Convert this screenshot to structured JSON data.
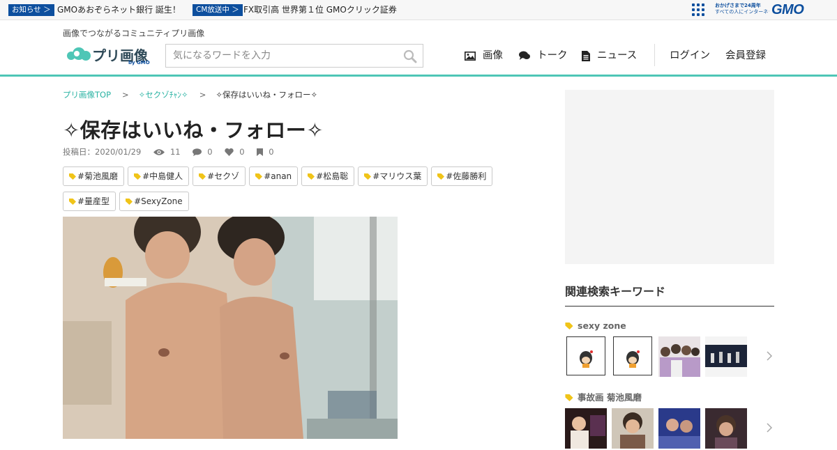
{
  "topbar": {
    "badge1": "お知らせ ＞",
    "text1": "GMOあおぞらネット銀行 誕生！",
    "badge2": "CM放送中 ＞",
    "text2": "FX取引高 世界第１位 GMOクリック証券",
    "gmo_tagline_1": "おかげさまで24周年",
    "gmo_tagline_2": "すべての人にインターネット",
    "gmo_logo": "GMO"
  },
  "header": {
    "tagline": "画像でつながるコミュニティプリ画像",
    "logo_text": "プリ画像",
    "logo_by": "by GMO",
    "search_placeholder": "気になるワードを入力",
    "nav": {
      "images": "画像",
      "talk": "トーク",
      "news": "ニュース",
      "login": "ログイン",
      "register": "会員登録"
    }
  },
  "breadcrumb": {
    "home": "プリ画像TOP",
    "category": "✧セクゾﾁｬﾝ✧",
    "current": "✧保存はいいね・フォロー✧",
    "sep": ">"
  },
  "post": {
    "title": "✧保存はいいね・フォロー✧",
    "date": "投稿日：2020/01/29",
    "views": "11",
    "comments": "0",
    "likes": "0",
    "bookmarks": "0",
    "tags": [
      "#菊池風磨",
      "#中島健人",
      "#セクゾ",
      "#anan",
      "#松島聡",
      "#マリウス葉",
      "#佐藤勝利",
      "#量産型",
      "#SexyZone"
    ]
  },
  "sidebar": {
    "related_title": "関連検索キーワード",
    "keywords": [
      {
        "label": "sexy zone"
      },
      {
        "label": "事故画 菊池風磨"
      }
    ]
  },
  "colors": {
    "accent": "#4ec6b6",
    "link": "#2bb3a3",
    "gmo_blue": "#0d4f9e",
    "tag_icon": "#f0c419"
  },
  "icons": {
    "search": "magnifier-icon",
    "images": "image-icon",
    "talk": "speech-bubbles-icon",
    "news": "document-icon",
    "views": "eye-icon",
    "comments": "comment-icon",
    "likes": "heart-icon",
    "bookmarks": "bookmark-icon",
    "tag": "tag-icon",
    "next": "chevron-right-icon"
  }
}
